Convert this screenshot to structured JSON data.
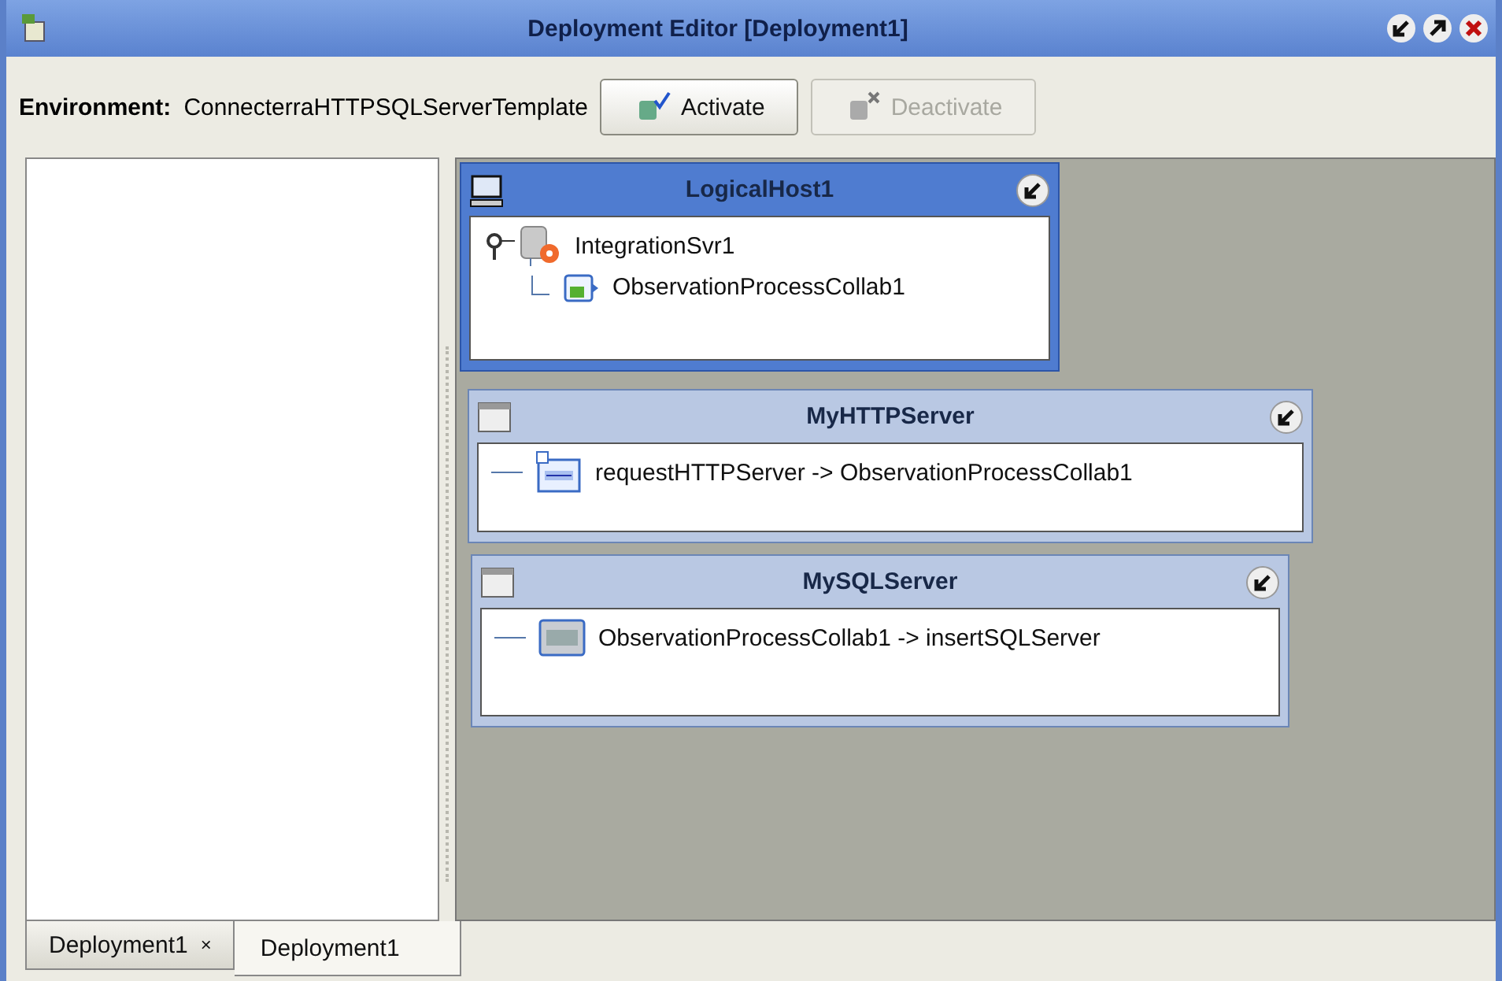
{
  "window": {
    "title": "Deployment Editor [Deployment1]"
  },
  "toolbar": {
    "environment_label": "Environment:",
    "environment_value": "ConnecterraHTTPSQLServerTemplate",
    "buttons": [
      {
        "label": "Activate",
        "disabled": false
      },
      {
        "label": "Deactivate",
        "disabled": true
      }
    ]
  },
  "nodes": [
    {
      "kind": "logical_host",
      "title": "LogicalHost1",
      "items": [
        {
          "kind": "server",
          "label": "IntegrationSvr1",
          "children": [
            {
              "kind": "collab",
              "label": "ObservationProcessCollab1"
            }
          ]
        }
      ]
    },
    {
      "kind": "external",
      "title": "MyHTTPServer",
      "items": [
        {
          "kind": "http",
          "label": "requestHTTPServer -> ObservationProcessCollab1"
        }
      ]
    },
    {
      "kind": "external",
      "title": "MySQLServer",
      "items": [
        {
          "kind": "sql",
          "label": "ObservationProcessCollab1 -> insertSQLServer"
        }
      ]
    }
  ],
  "tabs": [
    {
      "label": "Deployment1",
      "close": "×",
      "selected": false
    },
    {
      "label": "Deployment1",
      "selected": true
    }
  ]
}
